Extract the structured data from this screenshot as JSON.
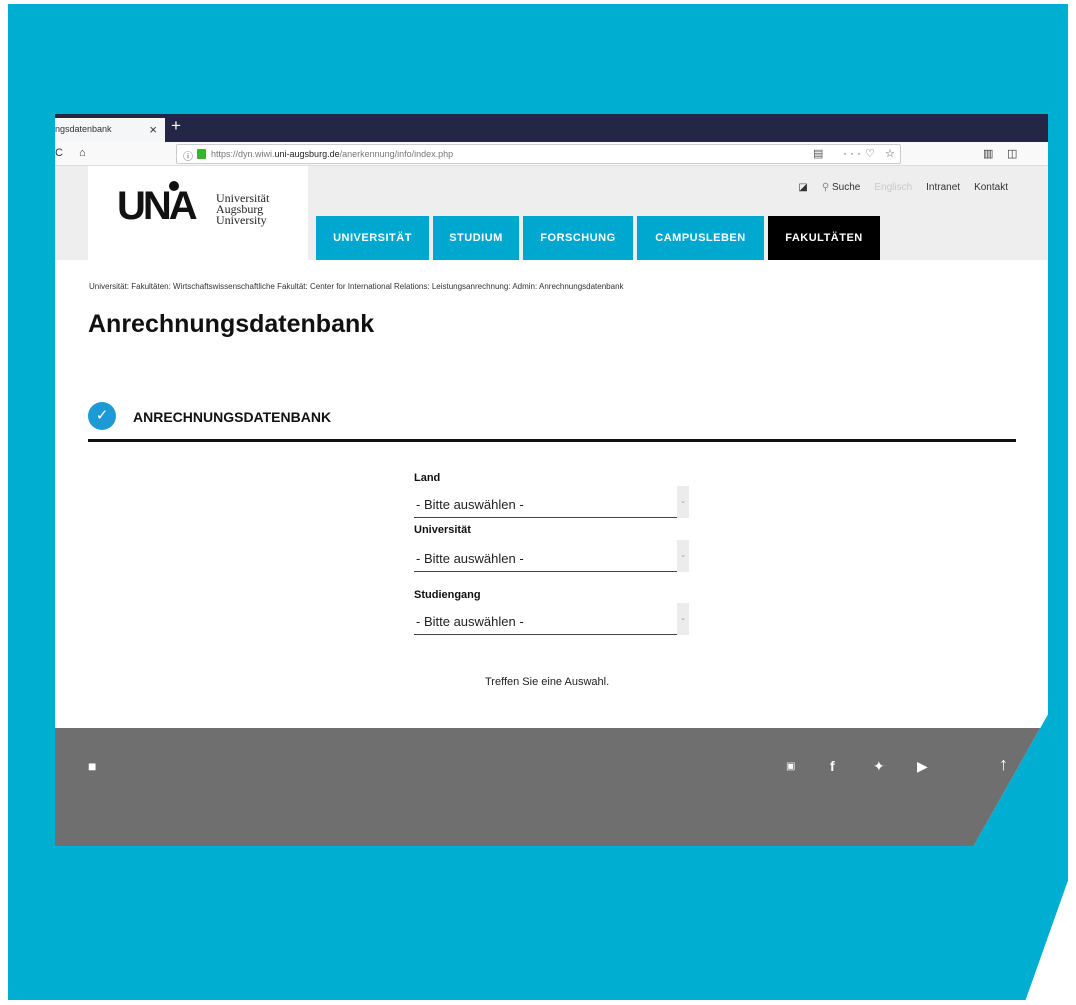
{
  "browser": {
    "tab_title": "ngsdatenbank",
    "tab_close": "×",
    "new_tab": "+",
    "url_prefix": "https://dyn.wiwi.",
    "url_domain": "uni-augsburg.de",
    "url_path": "/anerkennung/info/index.php"
  },
  "site": {
    "logo_mark": "UNA",
    "logo_line1": "Universität",
    "logo_line2": "Augsburg",
    "logo_line3": "University",
    "utility": {
      "search": "Suche",
      "english": "Englisch",
      "intranet": "Intranet",
      "contact": "Kontakt"
    },
    "nav": [
      "UNIVERSITÄT",
      "STUDIUM",
      "FORSCHUNG",
      "CAMPUSLEBEN",
      "FAKULTÄTEN"
    ]
  },
  "page": {
    "breadcrumb": "Universität: Fakultäten: Wirtschaftswissenschaftliche Fakultät: Center for International Relations: Leistungsanrechnung: Admin: Anrechnungsdatenbank",
    "title": "Anrechnungsdatenbank",
    "section_title": "ANRECHNUNGSDATENBANK",
    "form": {
      "land_label": "Land",
      "land_value": "- Bitte auswählen -",
      "uni_label": "Universität",
      "uni_value": "- Bitte auswählen -",
      "studiengang_label": "Studiengang",
      "studiengang_value": "- Bitte auswählen -"
    },
    "hint": "Treffen Sie eine Auswahl."
  },
  "footer": {
    "scroll_top": "↑"
  },
  "colors": {
    "frame": "#00aed1",
    "nav": "#00a8cf",
    "nav_active": "#000000",
    "footer": "#6f6f6f",
    "check": "#1d9ad6"
  }
}
